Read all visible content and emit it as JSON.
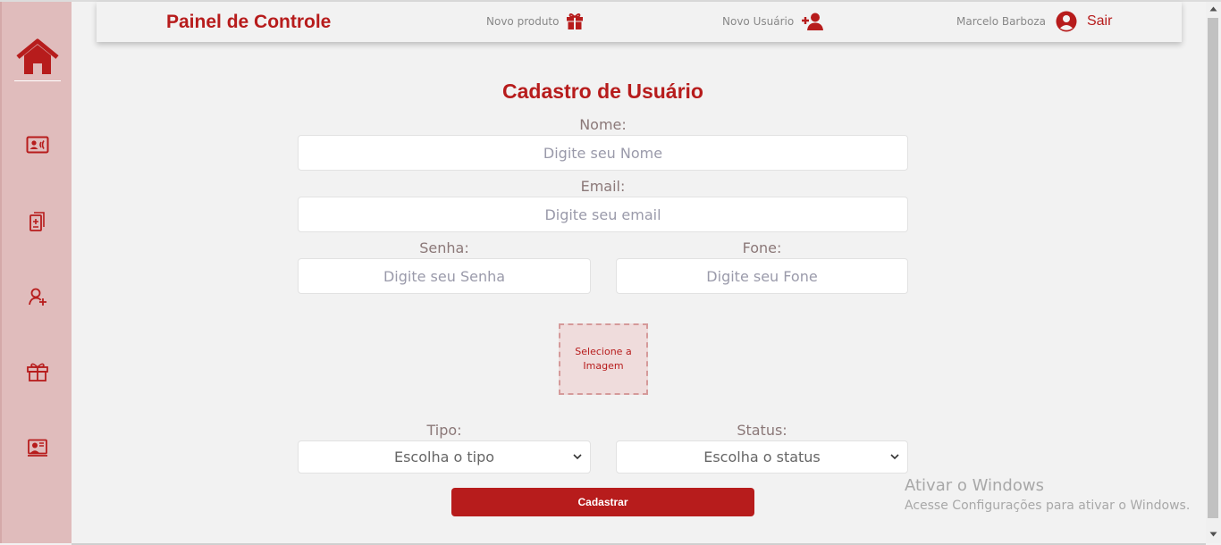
{
  "header": {
    "brand": "Painel de Controle",
    "new_product_label": "Novo produto",
    "new_user_label": "Novo Usuário",
    "user_name": "Marcelo Barboza",
    "logout_label": "Sair"
  },
  "sidebar": {
    "items": [
      "home-icon",
      "contact-card-icon",
      "document-icon",
      "user-add-icon",
      "gift-icon",
      "presentation-icon"
    ]
  },
  "form": {
    "title": "Cadastro de Usuário",
    "name_label": "Nome:",
    "name_placeholder": "Digite seu Nome",
    "email_label": "Email:",
    "email_placeholder": "Digite seu email",
    "password_label": "Senha:",
    "password_placeholder": "Digite seu Senha",
    "phone_label": "Fone:",
    "phone_placeholder": "Digite seu Fone",
    "image_label": "Selecione a Imagem",
    "type_label": "Tipo:",
    "type_selected": "Escolha o tipo",
    "status_label": "Status:",
    "status_selected": "Escolha o status",
    "submit_label": "Cadastrar"
  },
  "watermark": {
    "title": "Ativar o Windows",
    "subtitle": "Acesse Configurações para ativar o Windows."
  },
  "colors": {
    "accent": "#b71c1c",
    "sidebar_bg": "#e0bcbc",
    "page_bg": "#f2f2f2"
  }
}
